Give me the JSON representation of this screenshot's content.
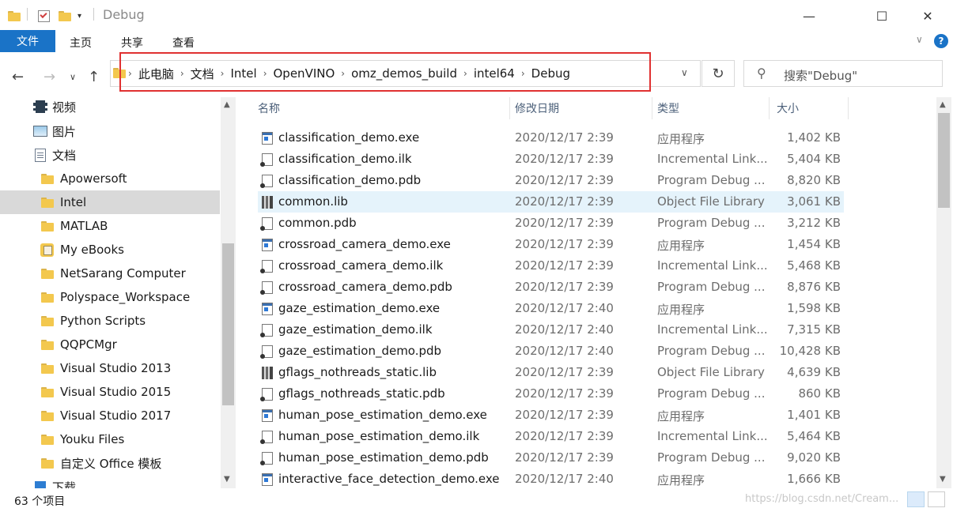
{
  "window": {
    "title": "Debug",
    "controls": [
      "—",
      "☐",
      "✕"
    ]
  },
  "ribbon": {
    "file_tab": "文件",
    "tabs": [
      "主页",
      "共享",
      "查看"
    ],
    "help": "?",
    "collapse": "∨"
  },
  "address": {
    "breadcrumbs": [
      "此电脑",
      "文档",
      "Intel",
      "OpenVINO",
      "omz_demos_build",
      "intel64",
      "Debug"
    ],
    "search_placeholder": "搜索\"Debug\""
  },
  "navigation": {
    "items": [
      {
        "label": "视频",
        "icon": "video-icon"
      },
      {
        "label": "图片",
        "icon": "image-icon"
      },
      {
        "label": "文档",
        "icon": "document-icon"
      },
      {
        "label": "Apowersoft",
        "icon": "folder-icon"
      },
      {
        "label": "Intel",
        "icon": "folder-icon",
        "selected": true
      },
      {
        "label": "MATLAB",
        "icon": "folder-icon"
      },
      {
        "label": "My eBooks",
        "icon": "ebook-folder-icon"
      },
      {
        "label": "NetSarang Computer",
        "icon": "folder-icon"
      },
      {
        "label": "Polyspace_Workspace",
        "icon": "folder-icon"
      },
      {
        "label": "Python Scripts",
        "icon": "folder-icon"
      },
      {
        "label": "QQPCMgr",
        "icon": "folder-icon"
      },
      {
        "label": "Visual Studio 2013",
        "icon": "folder-icon"
      },
      {
        "label": "Visual Studio 2015",
        "icon": "folder-icon"
      },
      {
        "label": "Visual Studio 2017",
        "icon": "folder-icon"
      },
      {
        "label": "Youku Files",
        "icon": "folder-icon"
      },
      {
        "label": "自定义 Office 模板",
        "icon": "folder-icon"
      },
      {
        "label": "下载",
        "icon": "download-icon"
      }
    ]
  },
  "columns": {
    "name": "名称",
    "date": "修改日期",
    "type": "类型",
    "size": "大小"
  },
  "files": [
    {
      "name": "classification_demo.exe",
      "date": "2020/12/17 2:39",
      "type": "应用程序",
      "size": "1,402 KB",
      "kind": "exe"
    },
    {
      "name": "classification_demo.ilk",
      "date": "2020/12/17 2:39",
      "type": "Incremental Link...",
      "size": "5,404 KB",
      "kind": "doc"
    },
    {
      "name": "classification_demo.pdb",
      "date": "2020/12/17 2:39",
      "type": "Program Debug ...",
      "size": "8,820 KB",
      "kind": "doc"
    },
    {
      "name": "common.lib",
      "date": "2020/12/17 2:39",
      "type": "Object File Library",
      "size": "3,061 KB",
      "kind": "lib",
      "hover": true
    },
    {
      "name": "common.pdb",
      "date": "2020/12/17 2:39",
      "type": "Program Debug ...",
      "size": "3,212 KB",
      "kind": "doc"
    },
    {
      "name": "crossroad_camera_demo.exe",
      "date": "2020/12/17 2:39",
      "type": "应用程序",
      "size": "1,454 KB",
      "kind": "exe"
    },
    {
      "name": "crossroad_camera_demo.ilk",
      "date": "2020/12/17 2:39",
      "type": "Incremental Link...",
      "size": "5,468 KB",
      "kind": "doc"
    },
    {
      "name": "crossroad_camera_demo.pdb",
      "date": "2020/12/17 2:39",
      "type": "Program Debug ...",
      "size": "8,876 KB",
      "kind": "doc"
    },
    {
      "name": "gaze_estimation_demo.exe",
      "date": "2020/12/17 2:40",
      "type": "应用程序",
      "size": "1,598 KB",
      "kind": "exe"
    },
    {
      "name": "gaze_estimation_demo.ilk",
      "date": "2020/12/17 2:40",
      "type": "Incremental Link...",
      "size": "7,315 KB",
      "kind": "doc"
    },
    {
      "name": "gaze_estimation_demo.pdb",
      "date": "2020/12/17 2:40",
      "type": "Program Debug ...",
      "size": "10,428 KB",
      "kind": "doc"
    },
    {
      "name": "gflags_nothreads_static.lib",
      "date": "2020/12/17 2:39",
      "type": "Object File Library",
      "size": "4,639 KB",
      "kind": "lib"
    },
    {
      "name": "gflags_nothreads_static.pdb",
      "date": "2020/12/17 2:39",
      "type": "Program Debug ...",
      "size": "860 KB",
      "kind": "doc"
    },
    {
      "name": "human_pose_estimation_demo.exe",
      "date": "2020/12/17 2:39",
      "type": "应用程序",
      "size": "1,401 KB",
      "kind": "exe"
    },
    {
      "name": "human_pose_estimation_demo.ilk",
      "date": "2020/12/17 2:39",
      "type": "Incremental Link...",
      "size": "5,464 KB",
      "kind": "doc"
    },
    {
      "name": "human_pose_estimation_demo.pdb",
      "date": "2020/12/17 2:39",
      "type": "Program Debug ...",
      "size": "9,020 KB",
      "kind": "doc"
    },
    {
      "name": "interactive_face_detection_demo.exe",
      "date": "2020/12/17 2:40",
      "type": "应用程序",
      "size": "1,666 KB",
      "kind": "exe"
    }
  ],
  "status": {
    "item_count": "63 个项目",
    "watermark": "https://blog.csdn.net/Cream..."
  }
}
